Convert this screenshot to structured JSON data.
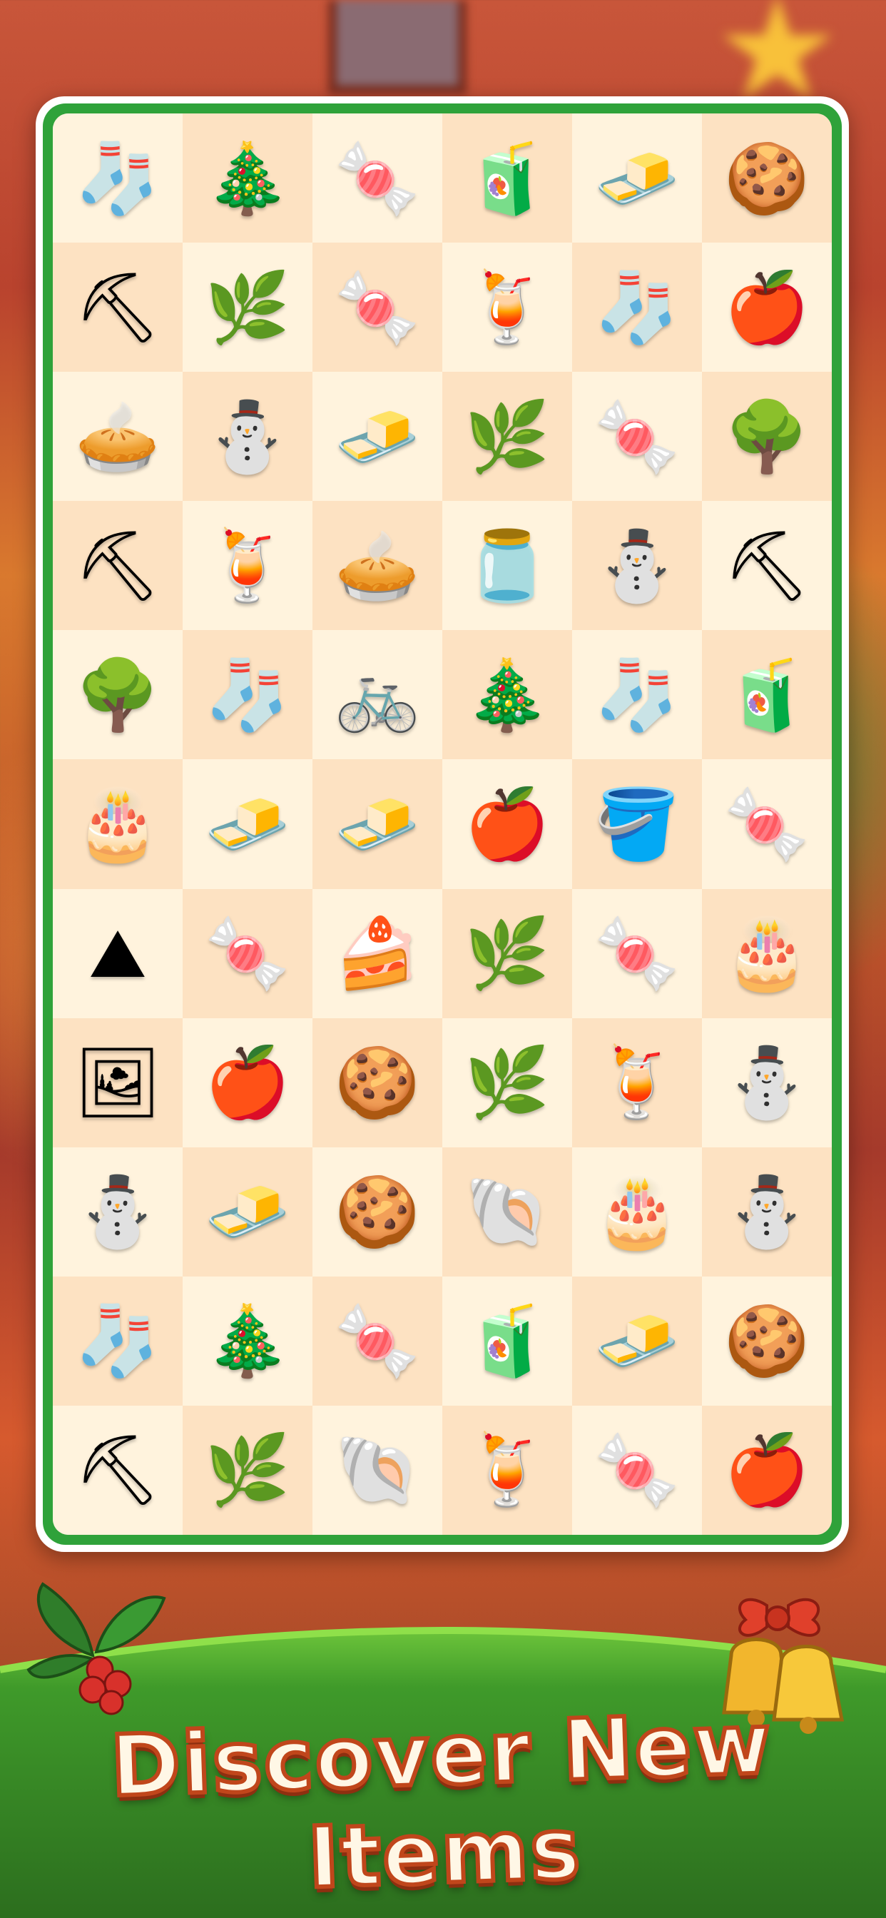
{
  "banner": {
    "title": "Discover New Items"
  },
  "board": {
    "rows": [
      [
        {
          "item": "stocking",
          "glyph": "🧦"
        },
        {
          "item": "christmas-tree",
          "glyph": "🎄"
        },
        {
          "item": "candy-cane",
          "glyph": "🍬"
        },
        {
          "item": "juice-bottle",
          "glyph": "🧃"
        },
        {
          "item": "juice-carton",
          "glyph": "🧈"
        },
        {
          "item": "gingerbread-man",
          "glyph": "🍪"
        }
      ],
      [
        {
          "item": "trowel",
          "glyph": "⛏"
        },
        {
          "item": "hazelnut-branch",
          "glyph": "🌿"
        },
        {
          "item": "candy-cane",
          "glyph": "🍬"
        },
        {
          "item": "iced-tea-jar",
          "glyph": "🍹"
        },
        {
          "item": "stocking",
          "glyph": "🧦"
        },
        {
          "item": "apple",
          "glyph": "🍎"
        }
      ],
      [
        {
          "item": "pie",
          "glyph": "🥧"
        },
        {
          "item": "snowman",
          "glyph": "⛄"
        },
        {
          "item": "juice-carton",
          "glyph": "🧈"
        },
        {
          "item": "hazelnut-branch",
          "glyph": "🌿"
        },
        {
          "item": "candy-cane",
          "glyph": "🍬"
        },
        {
          "item": "apple-tree",
          "glyph": "🌳"
        }
      ],
      [
        {
          "item": "trowel",
          "glyph": "⛏"
        },
        {
          "item": "iced-tea-jar",
          "glyph": "🍹"
        },
        {
          "item": "pie",
          "glyph": "🥧"
        },
        {
          "item": "jam-jar",
          "glyph": "🫙"
        },
        {
          "item": "snowman",
          "glyph": "⛄"
        },
        {
          "item": "shovel",
          "glyph": "⛏"
        }
      ],
      [
        {
          "item": "apple-tree",
          "glyph": "🌳"
        },
        {
          "item": "stocking",
          "glyph": "🧦"
        },
        {
          "item": "bicycle",
          "glyph": "🚲"
        },
        {
          "item": "christmas-tree",
          "glyph": "🎄"
        },
        {
          "item": "stocking",
          "glyph": "🧦"
        },
        {
          "item": "juice-bottle",
          "glyph": "🧃"
        }
      ],
      [
        {
          "item": "cake",
          "glyph": "🎂"
        },
        {
          "item": "juice-carton",
          "glyph": "🧈"
        },
        {
          "item": "juice-carton",
          "glyph": "🧈"
        },
        {
          "item": "apple",
          "glyph": "🍎"
        },
        {
          "item": "sand-bucket",
          "glyph": "🪣"
        },
        {
          "item": "candy-cane",
          "glyph": "🍬"
        }
      ],
      [
        {
          "item": "sand-pile",
          "glyph": "⛰"
        },
        {
          "item": "candy-cane",
          "glyph": "🍬"
        },
        {
          "item": "cake",
          "glyph": "🍰"
        },
        {
          "item": "holly",
          "glyph": "🌿"
        },
        {
          "item": "candy-cane",
          "glyph": "🍬"
        },
        {
          "item": "cake",
          "glyph": "🎂"
        }
      ],
      [
        {
          "item": "photos",
          "glyph": "🖼"
        },
        {
          "item": "apple",
          "glyph": "🍎"
        },
        {
          "item": "gingerbread-man",
          "glyph": "🍪"
        },
        {
          "item": "holly",
          "glyph": "🌿"
        },
        {
          "item": "iced-tea-jar",
          "glyph": "🍹"
        },
        {
          "item": "snowman",
          "glyph": "⛄"
        }
      ],
      [
        {
          "item": "snowman",
          "glyph": "⛄"
        },
        {
          "item": "juice-carton",
          "glyph": "🧈"
        },
        {
          "item": "gingerbread-man",
          "glyph": "🍪"
        },
        {
          "item": "seashell",
          "glyph": "🐚"
        },
        {
          "item": "cake",
          "glyph": "🎂"
        },
        {
          "item": "snowman",
          "glyph": "⛄"
        }
      ],
      [
        {
          "item": "stocking",
          "glyph": "🧦"
        },
        {
          "item": "christmas-tree",
          "glyph": "🎄"
        },
        {
          "item": "candy-cane",
          "glyph": "🍬"
        },
        {
          "item": "juice-bottle",
          "glyph": "🧃"
        },
        {
          "item": "juice-carton",
          "glyph": "🧈"
        },
        {
          "item": "gingerbread-man",
          "glyph": "🍪"
        }
      ],
      [
        {
          "item": "trowel",
          "glyph": "⛏"
        },
        {
          "item": "hazelnut-branch",
          "glyph": "🌿"
        },
        {
          "item": "seashell",
          "glyph": "🐚"
        },
        {
          "item": "iced-tea-jar",
          "glyph": "🍹"
        },
        {
          "item": "candy-cane",
          "glyph": "🍬"
        },
        {
          "item": "apple",
          "glyph": "🍎"
        }
      ]
    ]
  }
}
